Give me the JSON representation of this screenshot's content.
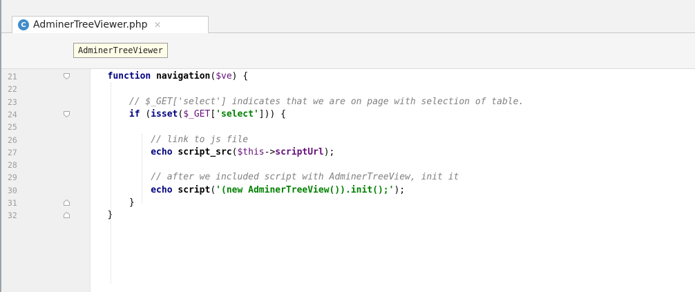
{
  "tab": {
    "icon_letter": "C",
    "filename": "AdminerTreeViewer.php",
    "close_glyph": "×"
  },
  "breadcrumb": {
    "label": "AdminerTreeViewer"
  },
  "editor": {
    "lines": [
      {
        "no": "21",
        "tokens": [
          [
            "pl",
            "        "
          ],
          [
            "kw",
            "function"
          ],
          [
            "pl",
            " "
          ],
          [
            "fn",
            "navigation"
          ],
          [
            "pl",
            "("
          ],
          [
            "var",
            "$ve"
          ],
          [
            "pl",
            ") {"
          ]
        ]
      },
      {
        "no": "22",
        "tokens": []
      },
      {
        "no": "23",
        "tokens": [
          [
            "pl",
            "            "
          ],
          [
            "cm",
            "// $_GET['select'] indicates that we are on page with selection of table."
          ]
        ]
      },
      {
        "no": "24",
        "tokens": [
          [
            "pl",
            "            "
          ],
          [
            "kw",
            "if"
          ],
          [
            "pl",
            " ("
          ],
          [
            "kw",
            "isset"
          ],
          [
            "pl",
            "("
          ],
          [
            "var",
            "$_GET"
          ],
          [
            "pl",
            "["
          ],
          [
            "str",
            "'select'"
          ],
          [
            "pl",
            "])) {"
          ]
        ]
      },
      {
        "no": "25",
        "tokens": []
      },
      {
        "no": "26",
        "tokens": [
          [
            "pl",
            "                "
          ],
          [
            "cm",
            "// link to js file"
          ]
        ]
      },
      {
        "no": "27",
        "tokens": [
          [
            "pl",
            "                "
          ],
          [
            "kw",
            "echo"
          ],
          [
            "pl",
            " "
          ],
          [
            "fn",
            "script_src"
          ],
          [
            "pl",
            "("
          ],
          [
            "var",
            "$this"
          ],
          [
            "pl",
            "->"
          ],
          [
            "prop",
            "scriptUrl"
          ],
          [
            "pl",
            ");"
          ]
        ]
      },
      {
        "no": "28",
        "tokens": []
      },
      {
        "no": "29",
        "tokens": [
          [
            "pl",
            "                "
          ],
          [
            "cm",
            "// after we included script with AdminerTreeView, init it"
          ]
        ]
      },
      {
        "no": "30",
        "tokens": [
          [
            "pl",
            "                "
          ],
          [
            "kw",
            "echo"
          ],
          [
            "pl",
            " "
          ],
          [
            "fn",
            "script"
          ],
          [
            "pl",
            "("
          ],
          [
            "str",
            "'(new AdminerTreeView()).init();'"
          ],
          [
            "pl",
            ");"
          ]
        ]
      },
      {
        "no": "31",
        "tokens": [
          [
            "pl",
            "            }"
          ]
        ]
      },
      {
        "no": "32",
        "tokens": [
          [
            "pl",
            "        }"
          ]
        ]
      }
    ]
  }
}
